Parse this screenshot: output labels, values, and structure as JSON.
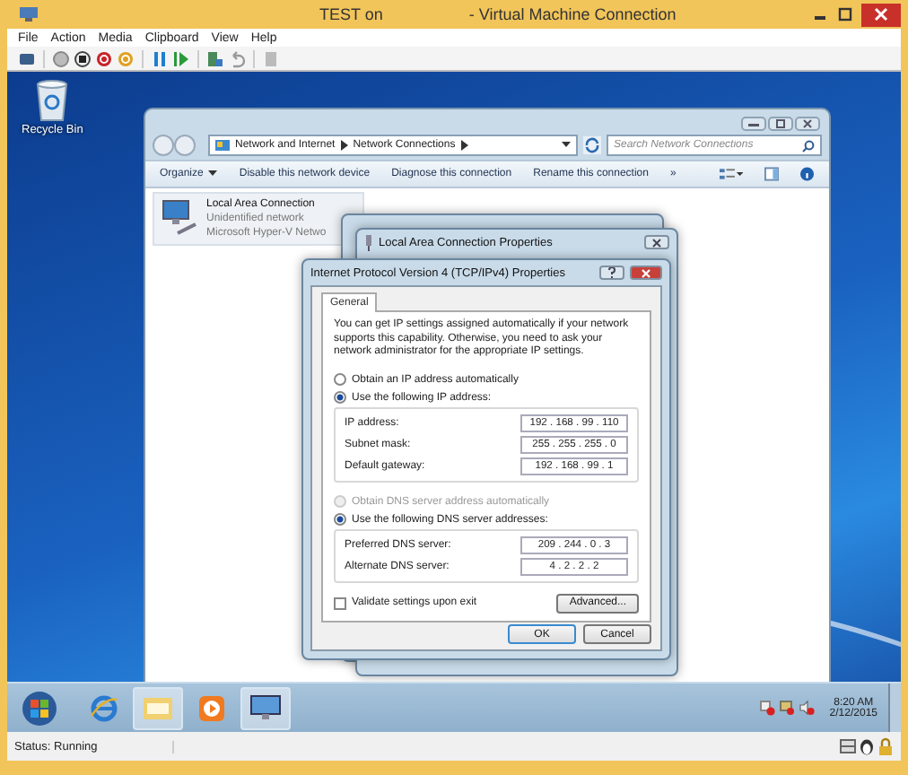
{
  "window": {
    "title": "TEST on",
    "title_suffix": "- Virtual Machine Connection"
  },
  "menu": [
    "File",
    "Action",
    "Media",
    "Clipboard",
    "View",
    "Help"
  ],
  "desktop_icons": [
    {
      "label": "Recycle Bin"
    }
  ],
  "explorer": {
    "breadcrumb": [
      "Network and Internet",
      "Network Connections"
    ],
    "search": {
      "placeholder": "Search Network Connections"
    },
    "commands": [
      "Organize",
      "Disable this network device",
      "Diagnose this connection",
      "Rename this connection"
    ],
    "more": "»",
    "connection": {
      "name": "Local Area Connection",
      "status": "Unidentified network",
      "adapter": "Microsoft Hyper-V Netwo"
    }
  },
  "properties_dialog": {
    "title": "Local Area Connection Properties"
  },
  "ipv4_dialog": {
    "title": "Internet Protocol Version 4 (TCP/IPv4) Properties",
    "tabs": [
      {
        "label": "General",
        "selected": true
      }
    ],
    "intro": "You can get IP settings assigned automatically if your network supports this capability. Otherwise, you need to ask your network administrator for the appropriate IP settings.",
    "ip_options": [
      {
        "label": "Obtain an IP address automatically",
        "selected": false,
        "disabled": false
      },
      {
        "label": "Use the following IP address:",
        "selected": true,
        "disabled": false
      }
    ],
    "ip_fields": [
      {
        "label": "IP address:",
        "value": "192 . 168 . 99 . 110"
      },
      {
        "label": "Subnet mask:",
        "value": "255 . 255 . 255 . 0"
      },
      {
        "label": "Default gateway:",
        "value": "192 . 168 . 99 . 1"
      }
    ],
    "dns_options": [
      {
        "label": "Obtain DNS server address automatically",
        "selected": false,
        "disabled": true
      },
      {
        "label": "Use the following DNS server addresses:",
        "selected": true,
        "disabled": false
      }
    ],
    "dns_fields": [
      {
        "label": "Preferred DNS server:",
        "value": "209 . 244 . 0 . 3"
      },
      {
        "label": "Alternate DNS server:",
        "value": "4 . 2 . 2 . 2"
      }
    ],
    "validate": {
      "label": "Validate settings upon exit",
      "checked": false
    },
    "advanced_button": "Advanced...",
    "buttons": [
      "OK",
      "Cancel"
    ]
  },
  "taskbar": {
    "apps": [
      {
        "kind": "browser",
        "selected": false
      },
      {
        "kind": "folder",
        "selected": true
      },
      {
        "kind": "media",
        "selected": false
      },
      {
        "kind": "network",
        "selected": true
      }
    ],
    "time": "8:20 AM",
    "date": "2/12/2015"
  },
  "status_bar": {
    "text": "Status: Running"
  }
}
